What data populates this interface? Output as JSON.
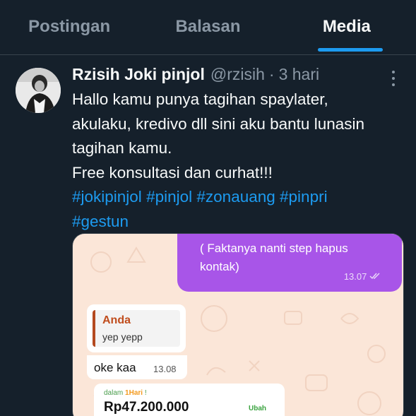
{
  "tabs": [
    {
      "label": "Postingan",
      "active": false
    },
    {
      "label": "Balasan",
      "active": false
    },
    {
      "label": "Media",
      "active": true
    }
  ],
  "accent_color": "#1d9bf0",
  "post": {
    "name": "Rzisih Joki pinjol",
    "handle": "@rzisih",
    "separator": "·",
    "time": "3 hari",
    "menu_icon": "more-vertical-icon",
    "text_lines": [
      "Hallo kamu punya tagihan spaylater,",
      "akulaku, kredivo dll sini aku bantu lunasin",
      "tagihan kamu.",
      "Free konsultasi dan curhat!!!"
    ],
    "hashtags": [
      "#jokipinjol",
      "#pinjol",
      "#zonauang",
      "#pinpri",
      "#gestun"
    ],
    "media": {
      "outgoing_text_line1": "( Faktanya nanti step hapus",
      "outgoing_text_line2": "kontak)",
      "outgoing_time": "13.07",
      "read_icon": "double-check-icon",
      "quote_sender": "Anda",
      "quote_text": "yep yepp",
      "reply_text": "oke kaa",
      "reply_time": "13.08",
      "loan_small_prefix": "dalam",
      "loan_small_highlight": "1Hari",
      "loan_small_suffix": "!",
      "loan_amount": "Rp47.200.000",
      "loan_edit": "Ubah"
    }
  }
}
